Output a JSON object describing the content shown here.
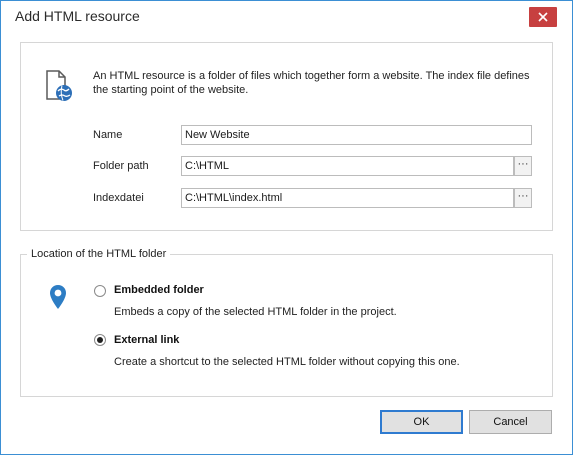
{
  "window": {
    "title": "Add HTML resource",
    "close_icon": "close-icon"
  },
  "info": {
    "icon": "html-document-globe-icon",
    "description": "An HTML resource is a folder of files which together form a website. The index file defines the starting point of the website."
  },
  "fields": {
    "name": {
      "label": "Name",
      "value": "New Website"
    },
    "folder_path": {
      "label": "Folder path",
      "value": "C:\\HTML",
      "browse_label": "···"
    },
    "index_file": {
      "label": "Indexdatei",
      "value": "C:\\HTML\\index.html",
      "browse_label": "···"
    }
  },
  "location": {
    "legend": "Location of the HTML folder",
    "icon": "location-pin-icon",
    "options": [
      {
        "title": "Embedded folder",
        "description": "Embeds a copy of the selected HTML folder in the project.",
        "checked": false
      },
      {
        "title": "External link",
        "description": "Create a shortcut to the selected HTML folder without copying this one.",
        "checked": true
      }
    ]
  },
  "buttons": {
    "ok": "OK",
    "cancel": "Cancel"
  },
  "colors": {
    "accent": "#2f7bd0",
    "close": "#c74040",
    "pin": "#2d7dc4",
    "border": "#3b8fd4"
  }
}
